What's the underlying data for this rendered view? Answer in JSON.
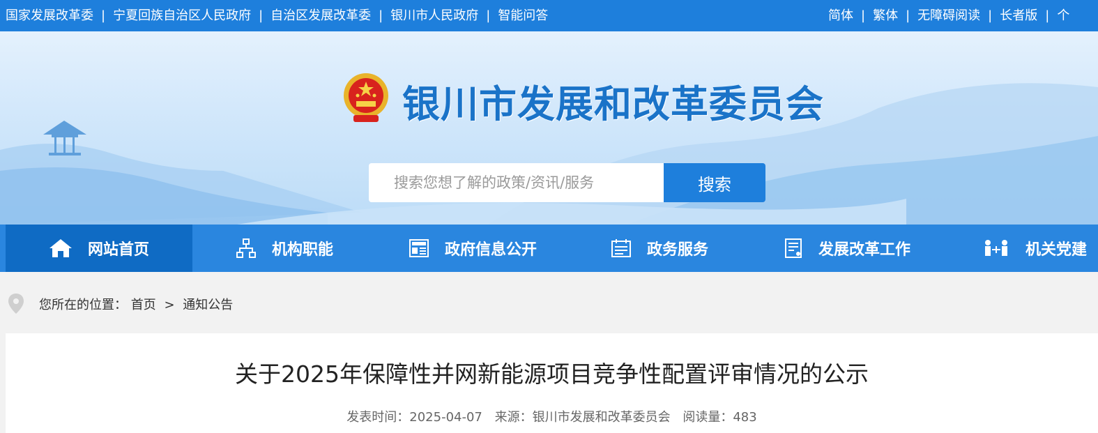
{
  "topbar": {
    "links_left": [
      "国家发展改革委",
      "宁夏回族自治区人民政府",
      "自治区发展改革委",
      "银川市人民政府",
      "智能问答"
    ],
    "links_right": [
      "简体",
      "繁体",
      "无障碍阅读",
      "长者版",
      "个"
    ],
    "separator": "|"
  },
  "header": {
    "title": "银川市发展和改革委员会",
    "emblem_icon": "national-emblem-icon"
  },
  "search": {
    "placeholder": "搜索您想了解的政策/资讯/服务",
    "button_label": "搜索"
  },
  "nav": {
    "items": [
      {
        "label": "网站首页",
        "icon": "home-icon",
        "active": true
      },
      {
        "label": "机构职能",
        "icon": "org-chart-icon",
        "active": false
      },
      {
        "label": "政府信息公开",
        "icon": "news-icon",
        "active": false
      },
      {
        "label": "政务服务",
        "icon": "service-icon",
        "active": false
      },
      {
        "label": "发展改革工作",
        "icon": "document-icon",
        "active": false
      },
      {
        "label": "机关党建",
        "icon": "people-icon",
        "active": false
      }
    ]
  },
  "breadcrumb": {
    "prefix": "您所在的位置：",
    "home": "首页",
    "separator": ">",
    "current": "通知公告"
  },
  "article": {
    "title": "关于2025年保障性并网新能源项目竞争性配置评审情况的公示",
    "publish_label": "发表时间：",
    "publish_date": "2025-04-07",
    "source_label": "来源：",
    "source": "银川市发展和改革委员会",
    "views_label": "阅读量：",
    "views": "483"
  },
  "colors": {
    "primary": "#1e7fdc",
    "nav_active": "#0f6bc4",
    "title_blue": "#1a73c8"
  }
}
